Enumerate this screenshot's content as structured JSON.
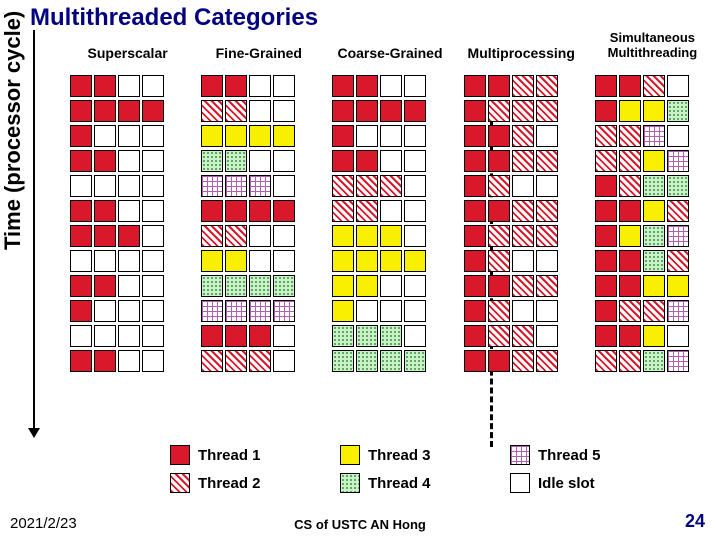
{
  "title": "Multithreaded Categories",
  "ylabel": "Time (processor cycle)",
  "columns": [
    {
      "label": "Superscalar",
      "two_line": false
    },
    {
      "label": "Fine-Grained",
      "two_line": false
    },
    {
      "label": "Coarse-Grained",
      "two_line": false
    },
    {
      "label": "Multiprocessing",
      "two_line": false
    },
    {
      "label": "Simultaneous\nMultithreading",
      "two_line": true
    }
  ],
  "legend_items": [
    {
      "label": "Thread 1",
      "class": "t1"
    },
    {
      "label": "Thread 3",
      "class": "t3"
    },
    {
      "label": "Thread 5",
      "class": "t5"
    },
    {
      "label": "Thread 2",
      "class": "t2"
    },
    {
      "label": "Thread 4",
      "class": "t4"
    },
    {
      "label": "Idle slot",
      "class": "idle"
    }
  ],
  "footer": {
    "date": "2021/2/23",
    "center": "CS of USTC AN Hong",
    "page": "24"
  },
  "chart_data": {
    "type": "table",
    "title": "Multithreaded Categories",
    "ylabel": "Time (processor cycle)",
    "slots_per_row": 4,
    "rows": 12,
    "threads": {
      "t1": "Thread 1",
      "t2": "Thread 2",
      "t3": "Thread 3",
      "t4": "Thread 4",
      "t5": "Thread 5",
      "i": "Idle slot"
    },
    "grids": {
      "Superscalar": [
        [
          "t1",
          "t1",
          "i",
          "i"
        ],
        [
          "t1",
          "t1",
          "t1",
          "t1"
        ],
        [
          "t1",
          "i",
          "i",
          "i"
        ],
        [
          "t1",
          "t1",
          "i",
          "i"
        ],
        [
          "i",
          "i",
          "i",
          "i"
        ],
        [
          "t1",
          "t1",
          "i",
          "i"
        ],
        [
          "t1",
          "t1",
          "t1",
          "i"
        ],
        [
          "i",
          "i",
          "i",
          "i"
        ],
        [
          "t1",
          "t1",
          "i",
          "i"
        ],
        [
          "t1",
          "i",
          "i",
          "i"
        ],
        [
          "i",
          "i",
          "i",
          "i"
        ],
        [
          "t1",
          "t1",
          "i",
          "i"
        ]
      ],
      "Fine-Grained": [
        [
          "t1",
          "t1",
          "i",
          "i"
        ],
        [
          "t2",
          "t2",
          "i",
          "i"
        ],
        [
          "t3",
          "t3",
          "t3",
          "t3"
        ],
        [
          "t4",
          "t4",
          "i",
          "i"
        ],
        [
          "t5",
          "t5",
          "t5",
          "i"
        ],
        [
          "t1",
          "t1",
          "t1",
          "t1"
        ],
        [
          "t2",
          "t2",
          "i",
          "i"
        ],
        [
          "t3",
          "t3",
          "i",
          "i"
        ],
        [
          "t4",
          "t4",
          "t4",
          "t4"
        ],
        [
          "t5",
          "t5",
          "t5",
          "t5"
        ],
        [
          "t1",
          "t1",
          "t1",
          "i"
        ],
        [
          "t2",
          "t2",
          "t2",
          "i"
        ]
      ],
      "Coarse-Grained": [
        [
          "t1",
          "t1",
          "i",
          "i"
        ],
        [
          "t1",
          "t1",
          "t1",
          "t1"
        ],
        [
          "t1",
          "i",
          "i",
          "i"
        ],
        [
          "t1",
          "t1",
          "i",
          "i"
        ],
        [
          "t2",
          "t2",
          "t2",
          "i"
        ],
        [
          "t2",
          "t2",
          "i",
          "i"
        ],
        [
          "t3",
          "t3",
          "t3",
          "i"
        ],
        [
          "t3",
          "t3",
          "t3",
          "t3"
        ],
        [
          "t3",
          "t3",
          "i",
          "i"
        ],
        [
          "t3",
          "i",
          "i",
          "i"
        ],
        [
          "t4",
          "t4",
          "t4",
          "i"
        ],
        [
          "t4",
          "t4",
          "t4",
          "t4"
        ]
      ],
      "Multiprocessing": [
        [
          "t1",
          "t1",
          "t2",
          "t2"
        ],
        [
          "t1",
          "t2",
          "t2",
          "t2"
        ],
        [
          "t1",
          "t1",
          "t2",
          "i"
        ],
        [
          "t1",
          "t1",
          "t2",
          "t2"
        ],
        [
          "t1",
          "t2",
          "i",
          "i"
        ],
        [
          "t1",
          "t1",
          "t2",
          "t2"
        ],
        [
          "t1",
          "t2",
          "t2",
          "t2"
        ],
        [
          "t1",
          "t2",
          "i",
          "i"
        ],
        [
          "t1",
          "t1",
          "t2",
          "t2"
        ],
        [
          "t1",
          "t2",
          "i",
          "i"
        ],
        [
          "t1",
          "t2",
          "t2",
          "i"
        ],
        [
          "t1",
          "t1",
          "t2",
          "t2"
        ]
      ],
      "Simultaneous Multithreading": [
        [
          "t1",
          "t1",
          "t2",
          "i"
        ],
        [
          "t1",
          "t3",
          "t3",
          "t4"
        ],
        [
          "t2",
          "t2",
          "t5",
          "i"
        ],
        [
          "t2",
          "t2",
          "t3",
          "t5"
        ],
        [
          "t1",
          "t2",
          "t4",
          "t4"
        ],
        [
          "t1",
          "t1",
          "t3",
          "t2"
        ],
        [
          "t1",
          "t3",
          "t4",
          "t5"
        ],
        [
          "t1",
          "t1",
          "t4",
          "t2"
        ],
        [
          "t1",
          "t1",
          "t3",
          "t3"
        ],
        [
          "t1",
          "t2",
          "t2",
          "t5"
        ],
        [
          "t1",
          "t1",
          "t3",
          "i"
        ],
        [
          "t2",
          "t2",
          "t4",
          "t5"
        ]
      ]
    }
  }
}
